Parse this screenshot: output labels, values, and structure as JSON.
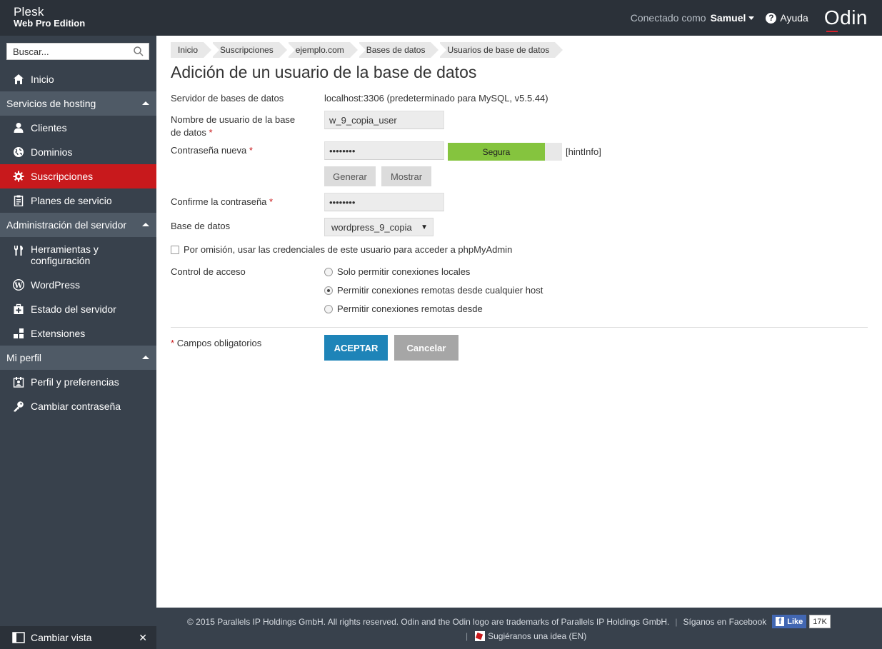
{
  "header": {
    "logo_line1": "Plesk",
    "logo_line2": "Web Pro Edition",
    "connected_as": "Conectado como",
    "username": "Samuel",
    "help": "Ayuda",
    "brand": "Odin"
  },
  "sidebar": {
    "search_placeholder": "Buscar...",
    "home": "Inicio",
    "sections": [
      {
        "label": "Servicios de hosting",
        "items": [
          "Clientes",
          "Dominios",
          "Suscripciones",
          "Planes de servicio"
        ]
      },
      {
        "label": "Administración del servidor",
        "items": [
          "Herramientas y configuración",
          "WordPress",
          "Estado del servidor",
          "Extensiones"
        ]
      },
      {
        "label": "Mi perfil",
        "items": [
          "Perfil y preferencias",
          "Cambiar contraseña"
        ]
      }
    ],
    "tools_line1": "Herramientas y",
    "tools_line2": "configuración",
    "switch_view": "Cambiar vista",
    "active_item": "Suscripciones"
  },
  "breadcrumbs": [
    "Inicio",
    "Suscripciones",
    "ejemplo.com",
    "Bases de datos",
    "Usuarios de base de datos"
  ],
  "page": {
    "title": "Adición de un usuario de la base de datos"
  },
  "form": {
    "server_label": "Servidor de bases de datos",
    "server_value": "localhost:3306 (predeterminado para MySQL, v5.5.44)",
    "username_label_1": "Nombre de usuario de la base",
    "username_label_2": "de datos",
    "username_value": "w_9_copia_user",
    "password_label": "Contraseña nueva",
    "password_value": "••••••••",
    "strength_label": "Segura",
    "strength_level": 0.85,
    "hint": "[hintInfo]",
    "generate_button": "Generar",
    "show_button": "Mostrar",
    "confirm_label": "Confirme la contraseña",
    "confirm_value": "••••••••",
    "database_label": "Base de datos",
    "database_value": "wordpress_9_copia",
    "phpmyadmin_checkbox": "Por omisión, usar las credenciales de este usuario para acceder a phpMyAdmin",
    "phpmyadmin_checked": false,
    "access_label": "Control de acceso",
    "access_options": [
      {
        "label": "Solo permitir conexiones locales",
        "selected": false
      },
      {
        "label": "Permitir conexiones remotas desde cualquier host",
        "selected": true
      },
      {
        "label": "Permitir conexiones remotas desde",
        "selected": false
      }
    ],
    "required_note": "Campos obligatorios",
    "required_mark": "*",
    "ok_button": "ACEPTAR",
    "cancel_button": "Cancelar"
  },
  "footer": {
    "copyright": "© 2015 Parallels IP Holdings GmbH. All rights reserved. Odin and the Odin logo are trademarks of Parallels IP Holdings GmbH.",
    "follow": "Síganos en Facebook",
    "like": "Like",
    "like_count": "17K",
    "idea": "Sugiéranos una idea (EN)"
  },
  "colors": {
    "topbar": "#2b3139",
    "sidebar": "#38414c",
    "section": "#4f5a66",
    "active": "#c8191c",
    "ok_button": "#1e84b8",
    "strength": "#85c43e"
  }
}
